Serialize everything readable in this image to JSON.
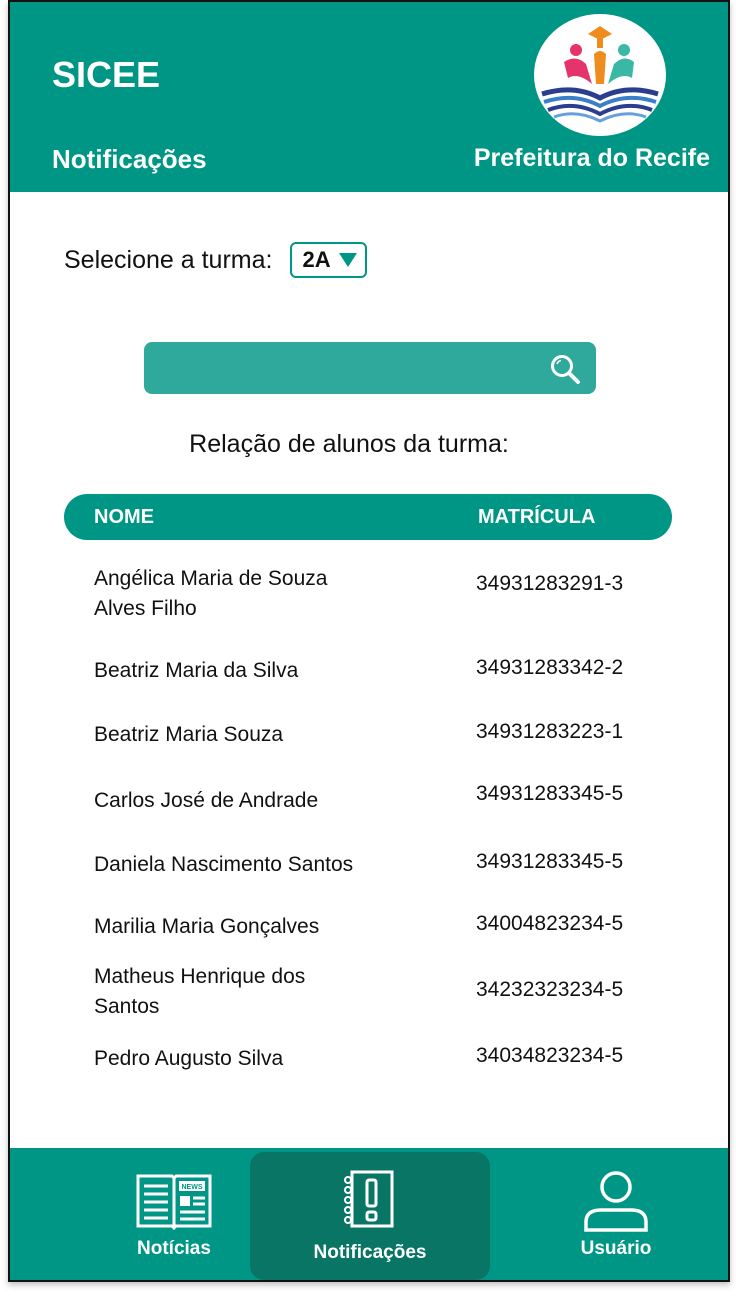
{
  "header": {
    "app_title": "SICEE",
    "page_title": "Notificações",
    "city": "Prefeitura do Recife",
    "logo_icon": "education-logo-icon"
  },
  "class_select": {
    "label": "Selecione a turma:",
    "value": "2A"
  },
  "search": {
    "placeholder": "",
    "value": "",
    "icon": "search-icon"
  },
  "list_title": "Relação de alunos da turma:",
  "table": {
    "headers": [
      "NOME",
      "MATRÍCULA"
    ],
    "rows": [
      {
        "name": "Angélica Maria de Souza Alves Filho",
        "matricula": "34931283291-3"
      },
      {
        "name": "Beatriz Maria da Silva",
        "matricula": "34931283342-2"
      },
      {
        "name": "Beatriz Maria Souza",
        "matricula": "34931283223-1"
      },
      {
        "name": "Carlos José de Andrade",
        "matricula": "34931283345-5"
      },
      {
        "name": "Daniela Nascimento Santos",
        "matricula": "34931283345-5"
      },
      {
        "name": "Marilia Maria Gonçalves",
        "matricula": "34004823234-5"
      },
      {
        "name": "Matheus Henrique dos Santos",
        "matricula": "34232323234-5"
      },
      {
        "name": "Pedro Augusto Silva",
        "matricula": "34034823234-5"
      }
    ]
  },
  "tabbar": {
    "items": [
      {
        "label": "Notícias",
        "icon": "newspaper-icon",
        "active": false
      },
      {
        "label": "Notificações",
        "icon": "notification-icon",
        "active": true
      },
      {
        "label": "Usuário",
        "icon": "user-icon",
        "active": false
      }
    ]
  },
  "colors": {
    "primary": "#009685",
    "primary_dark": "#087565",
    "search_bg": "#2ea99b"
  }
}
